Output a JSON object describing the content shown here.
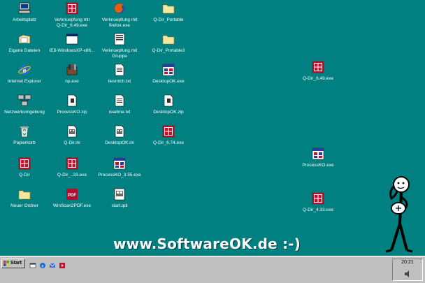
{
  "desktop": {
    "icons": [
      {
        "label": "Arbeitsplatz",
        "icon": "my-computer-icon"
      },
      {
        "label": "Verknuepfung mit\nQ-Dir_6.49.exe",
        "icon": "qdir-icon"
      },
      {
        "label": "Verknuepfung mit\nfirefox.exe",
        "icon": "firefox-icon"
      },
      {
        "label": "Q-Dir_Portable",
        "icon": "folder-icon"
      },
      {
        "label": "Eigene Dateien",
        "icon": "my-documents-icon"
      },
      {
        "label": "IE8-WindowsXP-x86...",
        "icon": "window-app-icon"
      },
      {
        "label": "Verknuepfung mit\nGruppe",
        "icon": "group-shortcut-icon"
      },
      {
        "label": "Q-Dir_Portable3",
        "icon": "folder-icon"
      },
      {
        "label": "Internet Explorer",
        "icon": "internet-explorer-icon"
      },
      {
        "label": "np.exe",
        "icon": "installer-icon"
      },
      {
        "label": "liesmich.txt",
        "icon": "text-file-icon"
      },
      {
        "label": "DesktopOK.exe",
        "icon": "desktopok-icon"
      },
      {
        "label": "Netzwerkumgebung",
        "icon": "network-icon"
      },
      {
        "label": "ProcessKO.zip",
        "icon": "zip-file-icon"
      },
      {
        "label": "readme.txt",
        "icon": "text-file-icon"
      },
      {
        "label": "DesktopOK.zip",
        "icon": "zip-file-icon"
      },
      {
        "label": "Papierkorb",
        "icon": "recycle-bin-icon"
      },
      {
        "label": "Q-Dir.ini",
        "icon": "ini-file-icon"
      },
      {
        "label": "DesktopOK.ini",
        "icon": "ini-file-icon"
      },
      {
        "label": "Q-Dir_6.74.exe",
        "icon": "qdir-icon"
      },
      {
        "label": "Q-Dir",
        "icon": "qdir-icon"
      },
      {
        "label": "Q-Dir_..33.exe",
        "icon": "qdir-icon"
      },
      {
        "label": "ProcessKO_3.55.exe",
        "icon": "processko-icon"
      },
      {
        "label": "Neuer Ordner",
        "icon": "folder-icon"
      },
      {
        "label": "WinScan2PDF.exe",
        "icon": "winscan2pdf-icon"
      },
      {
        "label": "start.qdi",
        "icon": "qdi-file-icon"
      },
      {
        "label": "Q-Dir_6.49.exe",
        "icon": "qdir-icon"
      },
      {
        "label": "ProcessKO.exe",
        "icon": "processko-icon"
      },
      {
        "label": "Q-Dir_4.33.exe",
        "icon": "qdir-icon"
      }
    ]
  },
  "watermark": "www.SoftwareOK.de :-)",
  "taskbar": {
    "start_label": "Start",
    "quick_launch": [
      "show-desktop-icon",
      "internet-explorer-icon",
      "outlook-express-icon",
      "media-player-icon"
    ],
    "clock": "20:21"
  },
  "colors": {
    "desktop": "#008080",
    "taskbar": "#c0c0c0",
    "qdir_red": "#c8102e"
  }
}
